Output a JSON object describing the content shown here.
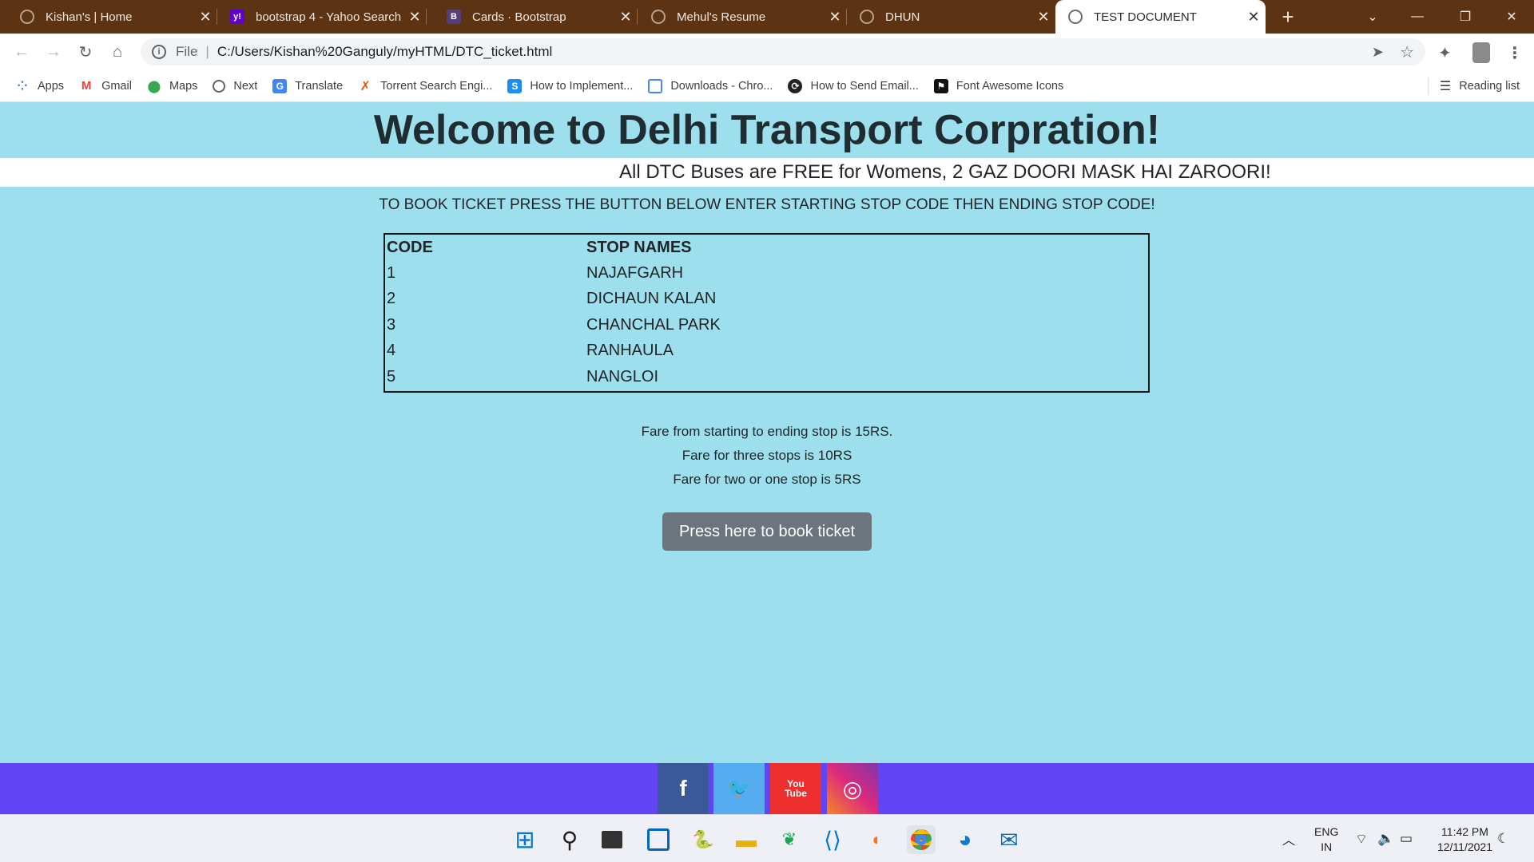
{
  "browser": {
    "tabs": [
      {
        "title": "Kishan's | Home",
        "icon": "globe-icon",
        "active": false
      },
      {
        "title": "bootstrap 4 - Yahoo Search",
        "icon": "yahoo-icon",
        "active": false
      },
      {
        "title": "Cards · Bootstrap",
        "icon": "bootstrap-icon",
        "active": false
      },
      {
        "title": "Mehul's Resume",
        "icon": "globe-icon",
        "active": false
      },
      {
        "title": "DHUN",
        "icon": "globe-icon",
        "active": false
      },
      {
        "title": "TEST DOCUMENT",
        "icon": "globe-icon",
        "active": true
      }
    ],
    "address": {
      "scheme": "File",
      "url": "C:/Users/Kishan%20Ganguly/myHTML/DTC_ticket.html"
    },
    "bookmarks": [
      {
        "label": "Apps",
        "icon": "apps-grid-icon"
      },
      {
        "label": "Gmail",
        "icon": "gmail-icon"
      },
      {
        "label": "Maps",
        "icon": "maps-pin-icon"
      },
      {
        "label": "Next",
        "icon": "globe-icon"
      },
      {
        "label": "Translate",
        "icon": "translate-icon"
      },
      {
        "label": "Torrent Search Engi...",
        "icon": "torrent-icon"
      },
      {
        "label": "How to Implement...",
        "icon": "s-icon"
      },
      {
        "label": "Downloads - Chro...",
        "icon": "downloads-icon"
      },
      {
        "label": "How to Send Email...",
        "icon": "gear-link-icon"
      },
      {
        "label": "Font Awesome Icons",
        "icon": "flag-icon"
      }
    ],
    "reading_list": "Reading list"
  },
  "page": {
    "heading": "Welcome to Delhi Transport Corpration!",
    "marquee": "All DTC Buses are FREE for Womens, 2 GAZ DOORI MASK HAI ZAROORI!",
    "instructions": "TO BOOK TICKET PRESS THE BUTTON BELOW ENTER STARTING STOP CODE THEN ENDING STOP CODE!",
    "table": {
      "headers": [
        "CODE",
        "STOP NAMES"
      ],
      "rows": [
        [
          "1",
          "NAJAFGARH"
        ],
        [
          "2",
          "DICHAUN KALAN"
        ],
        [
          "3",
          "CHANCHAL PARK"
        ],
        [
          "4",
          "RANHAULA"
        ],
        [
          "5",
          "NANGLOI"
        ]
      ]
    },
    "fares": [
      "Fare from starting to ending stop is 15RS.",
      "Fare for three stops is 10RS",
      "Fare for two or one stop is 5RS"
    ],
    "book_button": "Press here to book ticket"
  },
  "footer": {
    "social": [
      {
        "name": "facebook",
        "icon": "facebook-icon",
        "glyph": "f",
        "color": "#3b5998"
      },
      {
        "name": "twitter",
        "icon": "twitter-icon",
        "glyph": "🐦",
        "color": "#55acee"
      },
      {
        "name": "youtube",
        "icon": "youtube-icon",
        "glyph": "You\nTube",
        "color": "#ed302f"
      },
      {
        "name": "instagram",
        "icon": "instagram-icon",
        "glyph": "◎",
        "color": "#ac2bac"
      }
    ]
  },
  "taskbar": {
    "language": "ENG",
    "region": "IN",
    "time": "11:42 PM",
    "date": "12/11/2021"
  }
}
